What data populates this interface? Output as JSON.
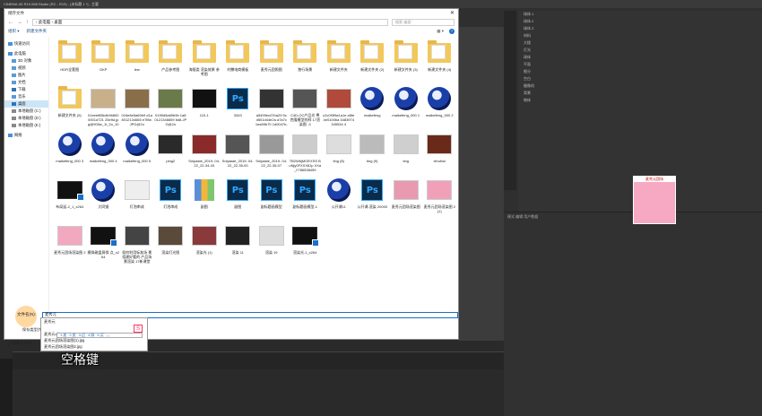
{
  "app": {
    "title": "CINEMA 4D R19.068 Studio (RC - R19) - [未标题 1 *] - 主要"
  },
  "dialog": {
    "title": "储存文件",
    "close": "✕",
    "address": "› 此电脑 › 桌面",
    "search_placeholder": "搜索\"桌面\"",
    "organize": "组织 ▾",
    "new_folder": "新建文件夹",
    "help": "?",
    "nav": [
      {
        "label": "快速访问",
        "sub": false,
        "sel": false,
        "color": "#4a90d9"
      },
      {
        "label": "此电脑",
        "sub": false,
        "sel": false,
        "color": "#4a90d9"
      },
      {
        "label": "3D 对象",
        "sub": true,
        "sel": false,
        "color": "#5b9bd5"
      },
      {
        "label": "视频",
        "sub": true,
        "sel": false,
        "color": "#5b9bd5"
      },
      {
        "label": "图片",
        "sub": true,
        "sel": false,
        "color": "#5b9bd5"
      },
      {
        "label": "文档",
        "sub": true,
        "sel": false,
        "color": "#5b9bd5"
      },
      {
        "label": "下载",
        "sub": true,
        "sel": false,
        "color": "#2e75b6"
      },
      {
        "label": "音乐",
        "sub": true,
        "sel": false,
        "color": "#5b9bd5"
      },
      {
        "label": "桌面",
        "sub": true,
        "sel": true,
        "color": "#2e75b6"
      },
      {
        "label": "本地磁盘 (C:)",
        "sub": true,
        "sel": false,
        "color": "#888888"
      },
      {
        "label": "本地磁盘 (D:)",
        "sub": true,
        "sel": false,
        "color": "#888888"
      },
      {
        "label": "本地磁盘 (E:)",
        "sub": true,
        "sel": false,
        "color": "#888888"
      },
      {
        "label": "网络",
        "sub": false,
        "sel": false,
        "color": "#4a90d9"
      }
    ],
    "files": [
      {
        "cap": "HDR全套图",
        "kind": "folder"
      },
      {
        "cap": "GKP",
        "kind": "folder"
      },
      {
        "cap": "lew",
        "kind": "folder"
      },
      {
        "cap": "产品参考图",
        "kind": "folder"
      },
      {
        "cap": "海报类 渲染效果 参考图",
        "kind": "folder"
      },
      {
        "cap": "村撒电商模板",
        "kind": "folder"
      },
      {
        "cap": "麦秀元团照图",
        "kind": "folder"
      },
      {
        "cap": "独行场景",
        "kind": "folder"
      },
      {
        "cap": "新建文件夹",
        "kind": "folder"
      },
      {
        "cap": "新建文件夹 (2)",
        "kind": "folder"
      },
      {
        "cap": "新建文件夹 (3)",
        "kind": "folder"
      },
      {
        "cap": "新建文件夹 (4)",
        "kind": "folder"
      },
      {
        "cap": "新建文件夹 (5)",
        "kind": "folder"
      },
      {
        "cap": "01eeef85b4b9b8000001d721 25e9d.jpg@900w_1l_2o_100sh",
        "kind": "photo",
        "color": "#c8b08a"
      },
      {
        "cap": "016e8e5a69b9 d1a8012134665 e7f8e.JPG@2o",
        "kind": "photo",
        "color": "#8a6e4a"
      },
      {
        "cap": "0195d5a69b9b 1a80121346659 bd8.JPG@2o",
        "kind": "photo",
        "color": "#6a7a4a"
      },
      {
        "cap": "110-1",
        "kind": "photo",
        "color": "#111111"
      },
      {
        "cap": "3343",
        "kind": "ps"
      },
      {
        "cap": "a5499ec07ba29 5cd501d44e2a a7a7c1ea59b70 1d0047b-skp...",
        "kind": "photo",
        "color": "#333333"
      },
      {
        "cap": "C4D-OC产品光 粤克隆模型的样 17渲染图 -3",
        "kind": "photo",
        "color": "#555555"
      },
      {
        "cap": "c2c0f3f9a1a1e a5fe4e0100ba 3483974345534 4",
        "kind": "photo",
        "color": "#b04a3a"
      },
      {
        "cap": "maikefeng",
        "kind": "c4d"
      },
      {
        "cap": "maikefeng_000 1",
        "kind": "c4d"
      },
      {
        "cap": "maikefeng_000 2",
        "kind": "c4d"
      },
      {
        "cap": "maikefeng_000 3",
        "kind": "c4d"
      },
      {
        "cap": "maikefeng_000 4",
        "kind": "c4d"
      },
      {
        "cap": "maikefeng_000 5",
        "kind": "c4d"
      },
      {
        "cap": "ping2",
        "kind": "photo",
        "color": "#2a2a2a"
      },
      {
        "cap": "Snipaste_2019- 04-22_22-34-43",
        "kind": "photo",
        "color": "#8a2a2a"
      },
      {
        "cap": "Snipaste_2019- 04-22_22-35-00",
        "kind": "photo",
        "color": "#555555"
      },
      {
        "cap": "Snipaste_2019- 04-22_22-35-07",
        "kind": "photo",
        "color": "#999999"
      },
      {
        "cap": "TB2WbjMOEXSS BuNjy0FXXX8Jp XXa_!!786538459",
        "kind": "photo",
        "color": "#cccccc"
      },
      {
        "cap": "ting (8)",
        "kind": "photo",
        "color": "#dddddd"
      },
      {
        "cap": "ting (9)",
        "kind": "photo",
        "color": "#bbbbbb"
      },
      {
        "cap": "ting",
        "kind": "photo",
        "color": "#cfcfcf"
      },
      {
        "cap": "xihuihui",
        "kind": "photo",
        "color": "#6a2a1a"
      },
      {
        "cap": "布局延-2_1_x264",
        "kind": "vid"
      },
      {
        "cap": "大同镜",
        "kind": "c4d"
      },
      {
        "cap": "灯泡串成",
        "kind": "photo",
        "color": "#eeeeee"
      },
      {
        "cap": "灯泡串成",
        "kind": "ps"
      },
      {
        "cap": "副图",
        "kind": "zip"
      },
      {
        "cap": "副图",
        "kind": "ps"
      },
      {
        "cap": "副标题画模型",
        "kind": "ps"
      },
      {
        "cap": "副标题画模型-1",
        "kind": "ps"
      },
      {
        "cap": "公开课11",
        "kind": "c4d"
      },
      {
        "cap": "公开课-渲染 20000",
        "kind": "ps"
      },
      {
        "cap": "麦秀元团场渲染图",
        "kind": "photo",
        "color": "#e89ab0"
      },
      {
        "cap": "麦秀元团场渲染图 2(1)",
        "kind": "photo",
        "color": "#f0a0b8"
      },
      {
        "cap": "麦秀元团场渲染图 2",
        "kind": "photo",
        "color": "#f2a9c0"
      },
      {
        "cap": "模拟磁盘屏保 点_x264",
        "kind": "vid"
      },
      {
        "cap": "如何利用标准场 景搭建好看的 产品场景渲染 17新课堂",
        "kind": "photo",
        "color": "#444444"
      },
      {
        "cap": "渲染灯光图",
        "kind": "photo",
        "color": "#5a4a3a"
      },
      {
        "cap": "渲染光 (1)",
        "kind": "photo",
        "color": "#8a3a3a"
      },
      {
        "cap": "渲染 11",
        "kind": "photo",
        "color": "#222222"
      },
      {
        "cap": "渲染 19",
        "kind": "photo",
        "color": "#dddddd"
      },
      {
        "cap": "渲染光-1_x264",
        "kind": "vid"
      }
    ],
    "filename_label": "文件名(N):",
    "filename_value": "麦秀元",
    "type_label": "保存类型(T):",
    "autocomplete": [
      "麦秀元",
      "麦秀元",
      "麦秀元ultimate.jpg",
      "麦秀元团场渲染图(1).jpg",
      "麦秀元团场渲染图2.jpg"
    ],
    "ime": [
      "1.麦",
      "2.卖",
      "3.迈",
      "4.脉",
      "5.买",
      "‹ ›"
    ],
    "ime_logo": "S",
    "hide_folders": "隐藏文件夹"
  },
  "c4d": {
    "objects": [
      "球体.1",
      "球体.2",
      "球体.3",
      "材料",
      "大楼",
      "灯光",
      "球体",
      "平面",
      "细分",
      "空白",
      "摄像机",
      "背景",
      "物体"
    ],
    "attr_tabs": "模式  编辑  用户数据",
    "right_thumb_label": "麦秀元团场"
  },
  "subtitle": "空格键",
  "colors": {
    "accent": "#1a6fc9",
    "folder": "#f2c85b",
    "ps": "#31a8ff"
  }
}
